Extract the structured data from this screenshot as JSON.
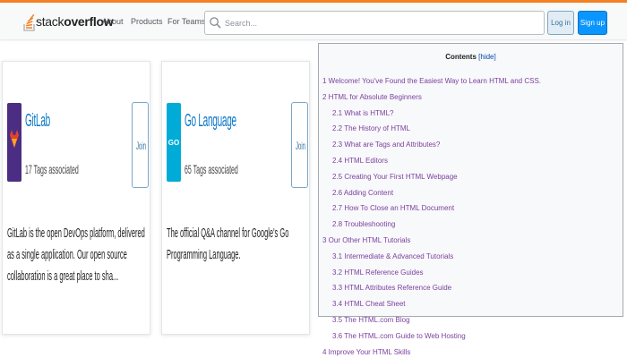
{
  "header": {
    "logo_regular": "stack",
    "logo_bold": "overflow",
    "nav": [
      "About",
      "Products",
      "For Teams"
    ],
    "search_placeholder": "Search...",
    "login_label": "Log in",
    "signup_label": "Sign up",
    "accent_color": "#f48024"
  },
  "cards": [
    {
      "name": "GitLab",
      "tags": "17 Tags associated",
      "join_label": "Join",
      "description": "GitLab is the open DevOps platform, delivered as a single application. Our open source collaboration is a great place to sha...",
      "logo_color": "#4b2e83"
    },
    {
      "name": "Go Language",
      "tags": "65 Tags associated",
      "join_label": "Join",
      "description": "The official Q&A channel for Google's Go Programming Language.",
      "logo_color": "#00acd7"
    }
  ],
  "toc": {
    "title": "Contents",
    "hide_label": "[hide]",
    "items": [
      {
        "text": "1 Welcome! You've Found the Easiest Way to Learn HTML and CSS.",
        "level": 1
      },
      {
        "text": "2 HTML for Absolute Beginners",
        "level": 1
      },
      {
        "text": "2.1 What is HTML?",
        "level": 2
      },
      {
        "text": "2.2 The History of HTML",
        "level": 2
      },
      {
        "text": "2.3 What are Tags and Attributes?",
        "level": 2
      },
      {
        "text": "2.4 HTML Editors",
        "level": 2
      },
      {
        "text": "2.5 Creating Your First HTML Webpage",
        "level": 2
      },
      {
        "text": "2.6 Adding Content",
        "level": 2
      },
      {
        "text": "2.7 How To Close an HTML Document",
        "level": 2
      },
      {
        "text": "2.8 Troubleshooting",
        "level": 2
      },
      {
        "text": "3 Our Other HTML Tutorials",
        "level": 1
      },
      {
        "text": "3.1 Intermediate & Advanced Tutorials",
        "level": 2
      },
      {
        "text": "3.2 HTML Reference Guides",
        "level": 2
      },
      {
        "text": "3.3 HTML Attributes Reference Guide",
        "level": 2
      },
      {
        "text": "3.4 HTML Cheat Sheet",
        "level": 2
      },
      {
        "text": "3.5 The HTML.com Blog",
        "level": 2
      },
      {
        "text": "3.6 The HTML.com Guide to Web Hosting",
        "level": 2
      },
      {
        "text": "4 Improve Your HTML Skills",
        "level": 1
      }
    ]
  }
}
